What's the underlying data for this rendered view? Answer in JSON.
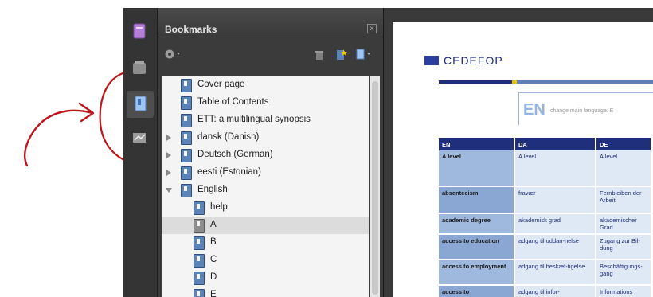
{
  "panel": {
    "title": "Bookmarks",
    "close_glyph": "x"
  },
  "bookmarks": [
    {
      "label": "Cover page",
      "indent": 0,
      "expander": "none",
      "icon": "bookmark-icon"
    },
    {
      "label": "Table of Contents",
      "indent": 0,
      "expander": "none",
      "icon": "bookmark-icon"
    },
    {
      "label": "ETT: a multilingual synopsis",
      "indent": 0,
      "expander": "none",
      "icon": "bookmark-icon"
    },
    {
      "label": "dansk (Danish)",
      "indent": 0,
      "expander": "collapsed",
      "icon": "bookmark-icon"
    },
    {
      "label": "Deutsch (German)",
      "indent": 0,
      "expander": "collapsed",
      "icon": "bookmark-icon"
    },
    {
      "label": "eesti (Estonian)",
      "indent": 0,
      "expander": "collapsed",
      "icon": "bookmark-icon"
    },
    {
      "label": "English",
      "indent": 0,
      "expander": "expanded",
      "icon": "bookmark-icon"
    },
    {
      "label": "help",
      "indent": 1,
      "expander": "none",
      "icon": "bookmark-icon"
    },
    {
      "label": "A",
      "indent": 1,
      "expander": "none",
      "icon": "bookmark-icon-gray",
      "selected": true
    },
    {
      "label": "B",
      "indent": 1,
      "expander": "none",
      "icon": "bookmark-icon"
    },
    {
      "label": "C",
      "indent": 1,
      "expander": "none",
      "icon": "bookmark-icon"
    },
    {
      "label": "D",
      "indent": 1,
      "expander": "none",
      "icon": "bookmark-icon"
    },
    {
      "label": "E",
      "indent": 1,
      "expander": "none",
      "icon": "bookmark-icon"
    }
  ],
  "document": {
    "logo_text": "CEDEFOP",
    "lang_code": "EN",
    "lang_hint": "change main language: E",
    "table_headers": [
      "EN",
      "DA",
      "DE"
    ],
    "table_rows": [
      [
        "A level",
        "A level",
        "A level"
      ],
      [
        "absenteeism",
        "fravær",
        "Fernbleiben der Arbeit"
      ],
      [
        "academic degree",
        "akademisk grad",
        "akademischer Grad"
      ],
      [
        "access to education",
        "adgang til uddan-nelse",
        "Zugang zur Bil-dung"
      ],
      [
        "access to employment",
        "adgang til beskæf-tigelse",
        "Beschäftigungs-gang"
      ],
      [
        "access to",
        "adgang til infor-",
        "Informations"
      ]
    ]
  },
  "colors": {
    "annotation": "#c0141b",
    "bookmark_blue": "#5b83b8",
    "cedefop_navy": "#1f2f7c"
  }
}
